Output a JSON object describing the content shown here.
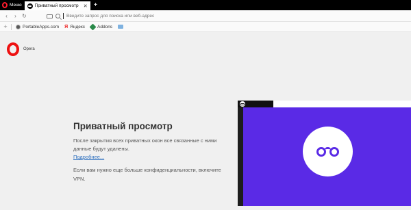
{
  "tabbar": {
    "menu_label": "Меню",
    "tabs": [
      {
        "title": "Приватный просмотр",
        "close": "✕"
      }
    ],
    "new_tab": "+"
  },
  "addressbar": {
    "back": "‹",
    "forward": "›",
    "reload": "↻",
    "placeholder": "Введите запрос для поиска или веб-адрес"
  },
  "bookmarks": {
    "add": "+",
    "items": [
      {
        "label": "PortableApps.com"
      },
      {
        "label": "Яндекс",
        "icon_text": "Я"
      },
      {
        "label": "Addons"
      }
    ]
  },
  "content": {
    "brand": "Opera",
    "heading": "Приватный просмотр",
    "description": "После закрытия всех приватных окон все связанные с ними данные будут удалены.",
    "more_link": "Подробнее...",
    "vpn_text": "Если вам нужно еще больше конфиденциальности, включите VPN."
  },
  "colors": {
    "accent_red": "#ff1b2d",
    "illustration_purple": "#5a2ae6",
    "link_blue": "#2c6fbf"
  }
}
